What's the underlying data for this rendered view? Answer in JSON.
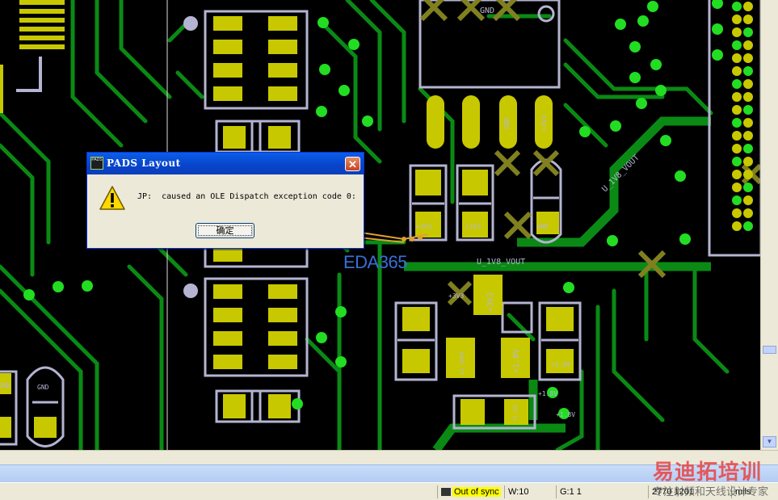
{
  "dialog": {
    "title": "PADS Layout",
    "message": "JP:  caused an OLE Dispatch exception code 0:",
    "ok_label": "确定",
    "close_glyph": "✕",
    "app_icon_text": "PADS"
  },
  "board_labels": {
    "gnd_top": "GND",
    "u1v8_vout_diag": "U_1V8_VOUT",
    "u1v8_vout": "U_1V8_VOUT",
    "p3v3_a": "+3V3",
    "p3v3_b": "+3V3",
    "p3v3_c": "+3V3",
    "p3v3_d": "+3V3",
    "p3v3_vert": "+3V3",
    "gnd_pad": "GND",
    "gnd_small": "GND",
    "gnd_left": "GND",
    "gnd_left2": "GND",
    "p18v_a": "+1.8V",
    "p18v_b": "+1.8V",
    "p18v_c": "+1.8V",
    "p18v_d": "+1.8V",
    "p18v_e": "+1.8V",
    "nvout": "V1_VOUT"
  },
  "status": {
    "sync": "Out of sync",
    "width": "W:10",
    "grid": "G:1 1",
    "coords": "2770    1201",
    "units": "mils"
  },
  "watermarks": {
    "eda": "EDA365",
    "brand": "易迪拓培训",
    "brand_sub": "专注射频和天线设计专家"
  },
  "colors": {
    "trace": "#0a8a14",
    "pad": "#c8c800",
    "outline": "#b4b4d2",
    "via": "#22dd22",
    "background": "#000000"
  }
}
